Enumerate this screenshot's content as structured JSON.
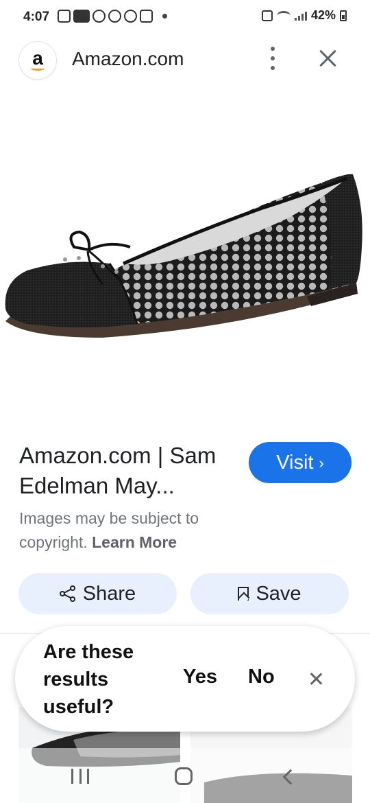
{
  "status_bar": {
    "time": "4:07",
    "battery": "42%",
    "left_icons": [
      "gallery-icon",
      "ebay-icon",
      "tag-icon",
      "tag-icon",
      "tag-icon",
      "instagram-icon",
      "dot-icon"
    ],
    "right_icons": [
      "nfc-icon",
      "wifi-icon",
      "signal-icon",
      "battery-icon"
    ]
  },
  "header": {
    "logo_letter": "a",
    "site": "Amazon.com"
  },
  "result": {
    "title": "Amazon.com | Sam Edelman May...",
    "visit_label": "Visit",
    "visit_chevron": "›",
    "copyright_text": "Images may be subject to copyright.",
    "learn_more": "Learn More"
  },
  "actions": {
    "share_label": "Share",
    "save_label": "Save"
  },
  "feedback": {
    "question": "Are these results useful?",
    "yes": "Yes",
    "no": "No"
  },
  "colors": {
    "accent": "#1a73e8",
    "tonal_button": "#e8f0fe",
    "secondary_text": "#70757a",
    "amazon_smile": "#f39c12"
  }
}
